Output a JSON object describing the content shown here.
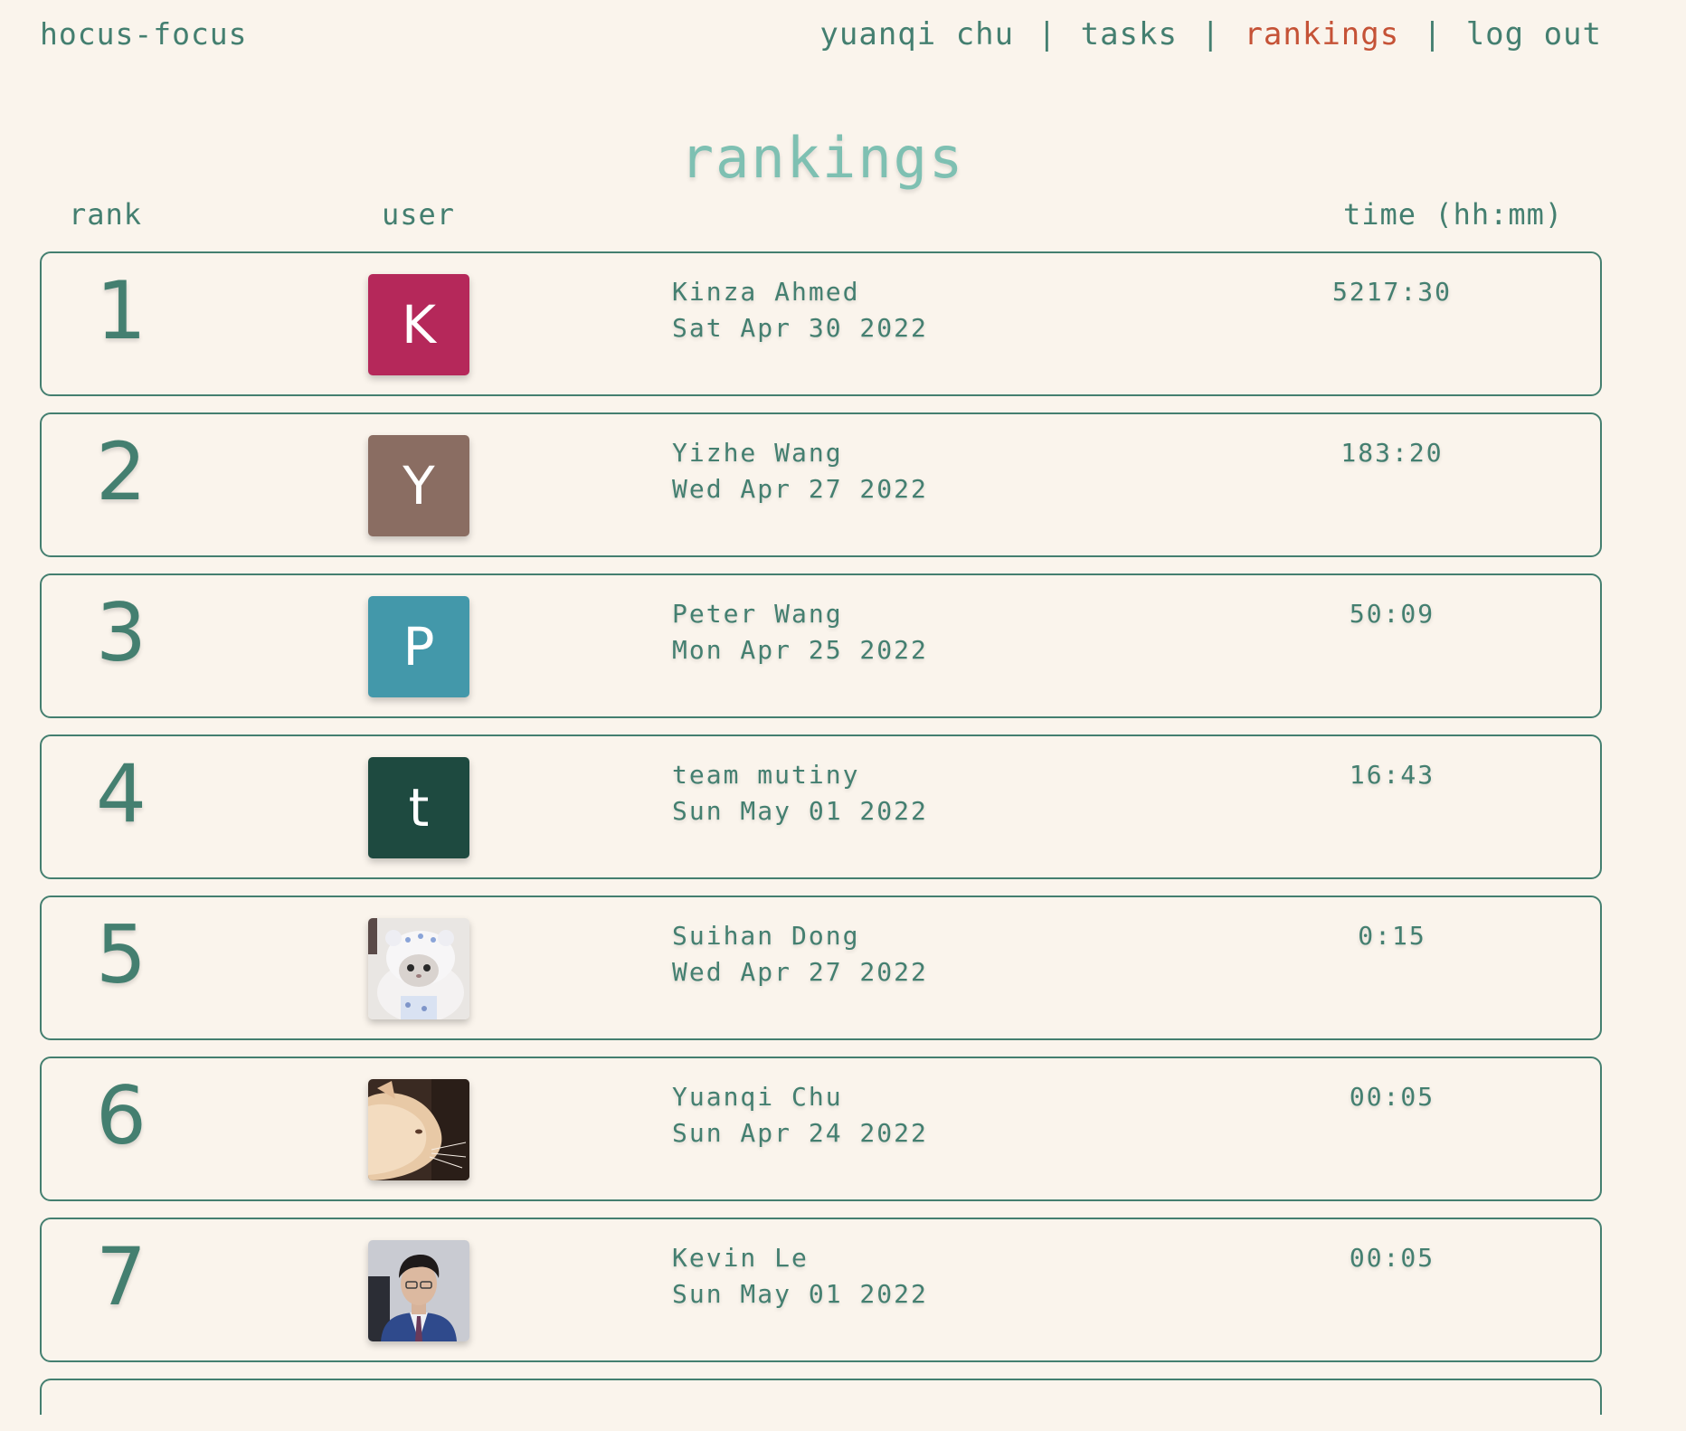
{
  "nav": {
    "brand": "hocus-focus",
    "links": [
      {
        "label": "yuanqi chu",
        "active": false
      },
      {
        "label": "tasks",
        "active": false
      },
      {
        "label": "rankings",
        "active": true
      },
      {
        "label": "log out",
        "active": false
      }
    ],
    "separator": "|",
    "active_color": "#c55236"
  },
  "page": {
    "title": "rankings"
  },
  "columns": {
    "rank": "rank",
    "user": "user",
    "time": "time (hh:mm)"
  },
  "rankings": [
    {
      "rank": "1",
      "avatar_letter": "K",
      "avatar_color": "#b5285a",
      "avatar_type": "letter",
      "name": "Kinza Ahmed",
      "date": "Sat Apr 30 2022",
      "time": "5217:30"
    },
    {
      "rank": "2",
      "avatar_letter": "Y",
      "avatar_color": "#8a6d62",
      "avatar_type": "letter",
      "name": "Yizhe Wang",
      "date": "Wed Apr 27 2022",
      "time": "183:20"
    },
    {
      "rank": "3",
      "avatar_letter": "P",
      "avatar_color": "#4398aa",
      "avatar_type": "letter",
      "name": "Peter Wang",
      "date": "Mon Apr 25 2022",
      "time": "50:09"
    },
    {
      "rank": "4",
      "avatar_letter": "t",
      "avatar_color": "#1e4a40",
      "avatar_type": "letter",
      "name": "team mutiny",
      "date": "Sun May 01 2022",
      "time": "16:43"
    },
    {
      "rank": "5",
      "avatar_type": "photo-white-cat",
      "name": "Suihan Dong",
      "date": "Wed Apr 27 2022",
      "time": "0:15"
    },
    {
      "rank": "6",
      "avatar_type": "photo-cat-profile",
      "name": "Yuanqi Chu",
      "date": "Sun Apr 24 2022",
      "time": "00:05"
    },
    {
      "rank": "7",
      "avatar_type": "photo-person",
      "name": "Kevin Le",
      "date": "Sun May 01 2022",
      "time": "00:05"
    }
  ]
}
